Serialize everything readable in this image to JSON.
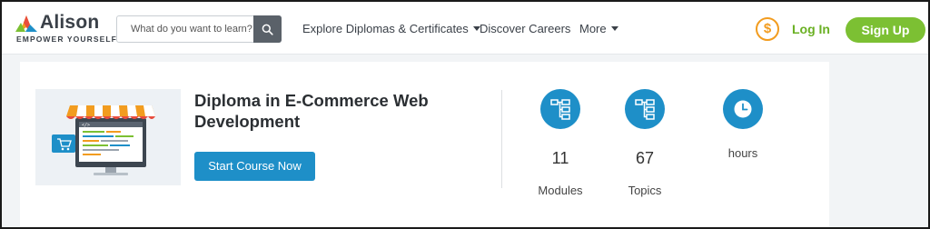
{
  "brand": {
    "name": "Alison",
    "tagline": "EMPOWER YOURSELF",
    "colors": {
      "orange": "#f29c1f",
      "red": "#e94c3d",
      "green": "#7cc033",
      "blue": "#1e8fc8"
    }
  },
  "header": {
    "search": {
      "placeholder": "What do you want to learn?",
      "value": ""
    },
    "nav": [
      {
        "label": "Explore Diplomas & Certificates",
        "dropdown": true
      },
      {
        "label": "Discover Careers",
        "dropdown": false
      },
      {
        "label": "More",
        "dropdown": true
      }
    ],
    "coin_symbol": "$",
    "login_label": "Log In",
    "signup_label": "Sign Up"
  },
  "course": {
    "title": "Diploma in E-Commerce Web Development",
    "start_label": "Start Course Now",
    "stats": [
      {
        "icon": "module-tree-icon",
        "value": "11",
        "label": "Modules"
      },
      {
        "icon": "topic-tree-icon",
        "value": "67",
        "label": "Topics"
      },
      {
        "icon": "clock-icon",
        "value": "",
        "label": "hours"
      }
    ]
  }
}
